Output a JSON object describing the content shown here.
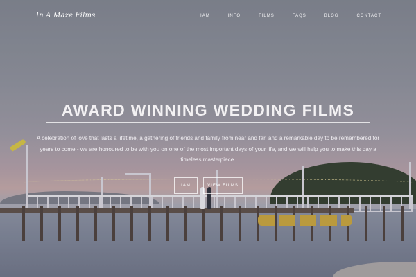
{
  "brand": {
    "logo_text": "In A Maze Films"
  },
  "nav": {
    "items": [
      {
        "label": "IAM"
      },
      {
        "label": "INFO"
      },
      {
        "label": "FILMS"
      },
      {
        "label": "FAQS"
      },
      {
        "label": "BLOG"
      },
      {
        "label": "CONTACT"
      }
    ]
  },
  "hero": {
    "headline": "AWARD WINNING WEDDING FILMS",
    "tagline": "A celebration of love that lasts a lifetime, a gathering of friends and family from near and far, and a remarkable day to be remembered for years to come - we are honoured to be with you on one of the most important days of your life, and we will help you to make this day a timeless masterpiece.",
    "buttons": {
      "iam": "IAM",
      "films": "VIEW FILMS"
    }
  }
}
